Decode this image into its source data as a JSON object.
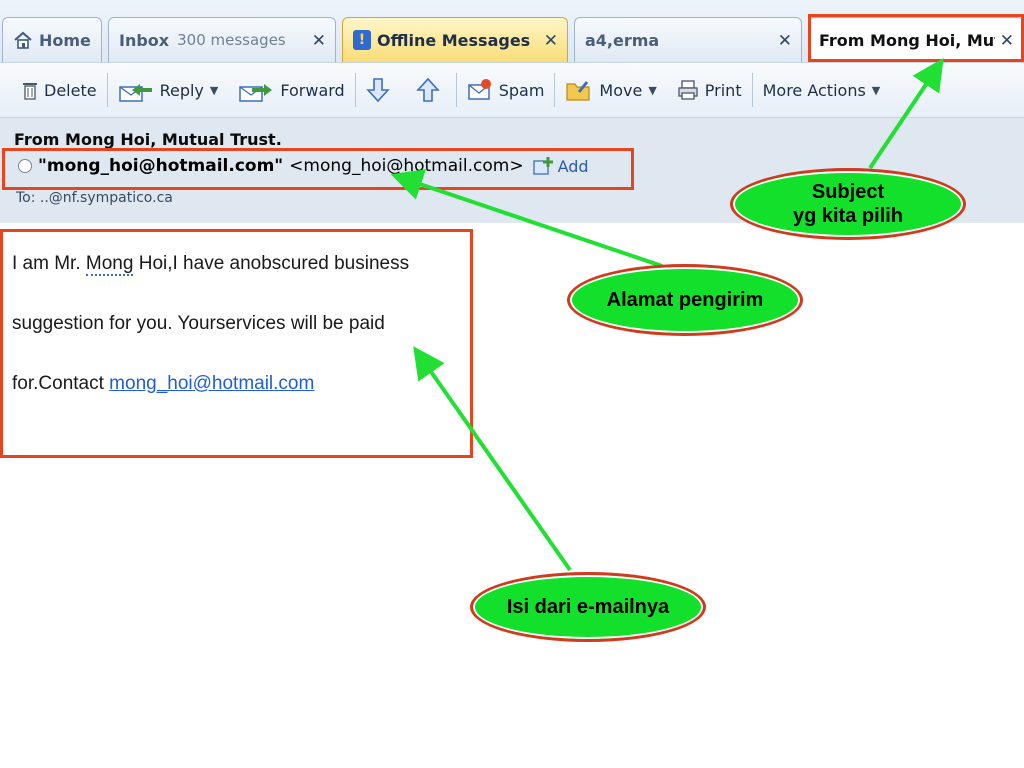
{
  "tabs": [
    {
      "label": "Home",
      "count": ""
    },
    {
      "label": "Inbox",
      "count": "300 messages"
    },
    {
      "label": "Offline Messages",
      "count": ""
    },
    {
      "label": "a4,erma",
      "count": ""
    },
    {
      "label": "From Mong Hoi, Mut",
      "count": ""
    }
  ],
  "toolbar": {
    "delete": "Delete",
    "reply": "Reply",
    "forward": "Forward",
    "spam": "Spam",
    "move": "Move",
    "print": "Print",
    "more_actions": "More Actions"
  },
  "message": {
    "subject_line": "From Mong Hoi, Mutual Trust.",
    "sender_name": "\"mong_hoi@hotmail.com\"",
    "sender_address": "<mong_hoi@hotmail.com>",
    "add_label": "Add",
    "to_line": "To:  ..@nf.sympatico.ca",
    "body_line1_pre": "I am Mr. ",
    "body_line1_word": "Mong",
    "body_line1_post": " Hoi,I have anobscured business",
    "body_line2": "suggestion for you. Yourservices will be paid",
    "body_line3_pre": "for.Contact ",
    "body_link": "mong_hoi@hotmail.com"
  },
  "annotations": {
    "subject": "Subject\nyg kita pilih",
    "sender": "Alamat pengirim",
    "content": "Isi dari e-mailnya"
  },
  "colors": {
    "highlight_box": "#e5451f",
    "arrow": "#22e033",
    "bubble_fill": "#13e02a"
  }
}
